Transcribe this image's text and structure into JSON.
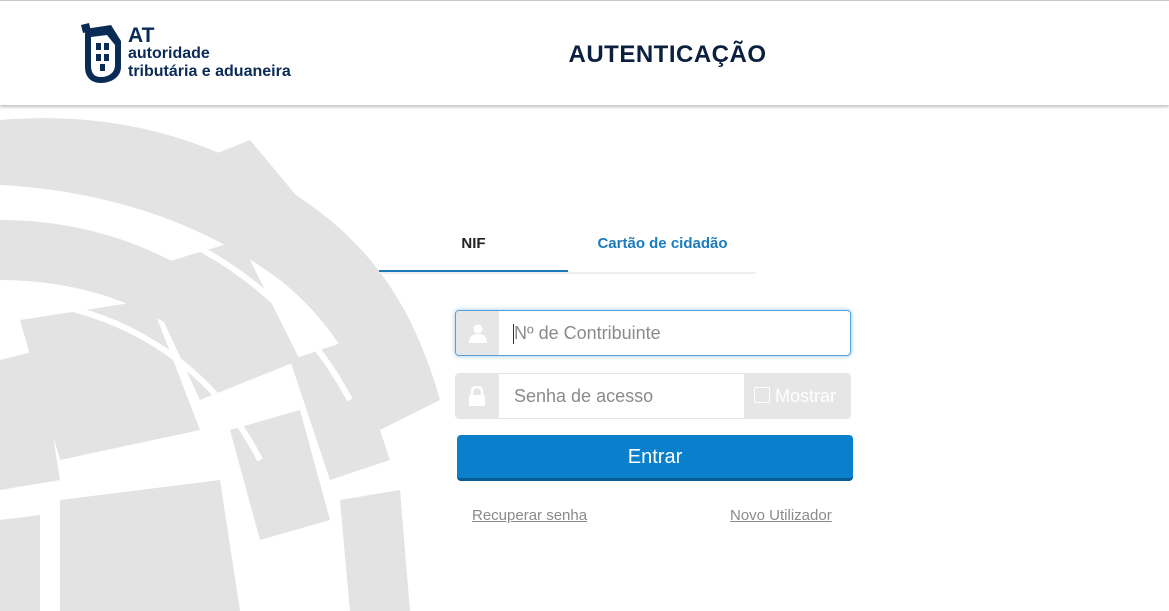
{
  "header": {
    "logo": {
      "abbr": "AT",
      "line1": "autoridade",
      "line2": "tributária e aduaneira"
    },
    "title": "AUTENTICAÇÃO"
  },
  "tabs": [
    {
      "label": "NIF",
      "active": true
    },
    {
      "label": "Cartão de cidadão",
      "active": false
    }
  ],
  "form": {
    "nif": {
      "placeholder": "Nº de Contribuinte",
      "value": "",
      "icon": "user-icon"
    },
    "password": {
      "placeholder": "Senha de acesso",
      "value": "",
      "icon": "lock-icon"
    },
    "show_password": {
      "label": "Mostrar",
      "checked": false
    },
    "submit_label": "Entrar"
  },
  "links": {
    "recover": "Recuperar senha",
    "new_user": "Novo Utilizador"
  },
  "colors": {
    "accent": "#0a7fcb",
    "title": "#0b1f3f",
    "link_tab": "#1b7bbd",
    "background_emblem": "#e3e3e3"
  }
}
